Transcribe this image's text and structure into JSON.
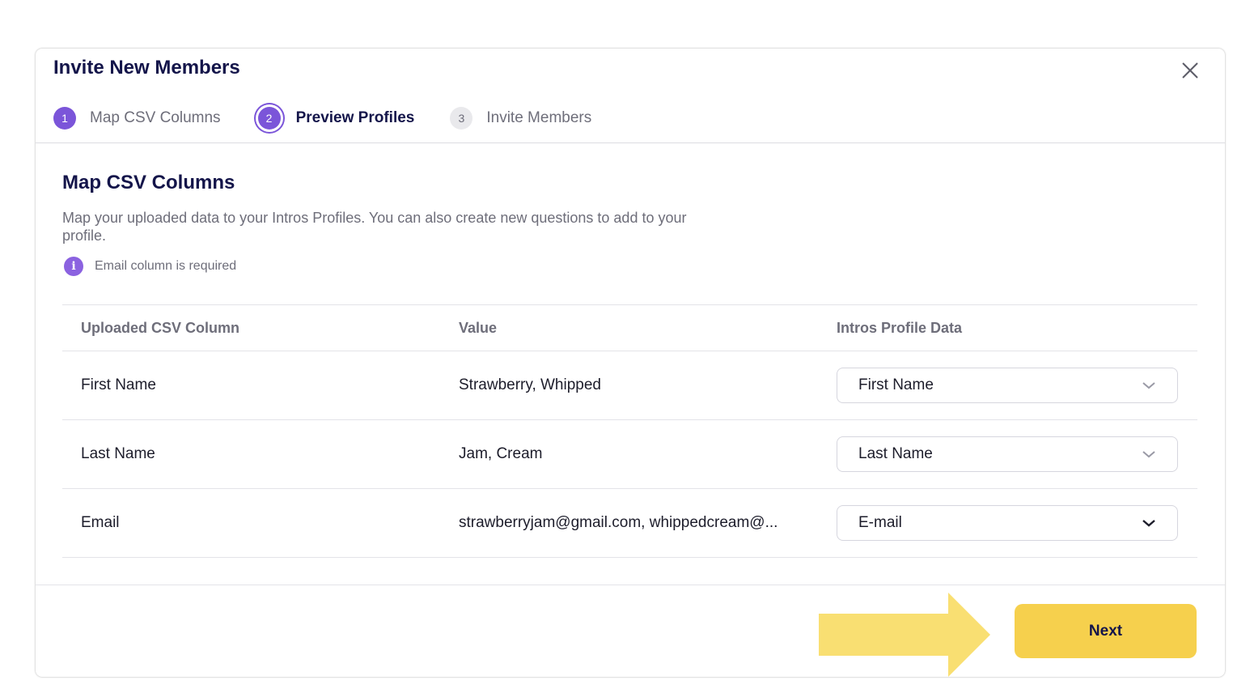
{
  "modal": {
    "title": "Invite New Members",
    "close_icon": "close-icon"
  },
  "stepper": {
    "steps": [
      {
        "number": "1",
        "label": "Map CSV Columns",
        "state": "completed"
      },
      {
        "number": "2",
        "label": "Preview Profiles",
        "state": "active"
      },
      {
        "number": "3",
        "label": "Invite Members",
        "state": "upcoming"
      }
    ]
  },
  "section": {
    "title": "Map CSV Columns",
    "description": "Map your uploaded data to your Intros Profiles. You can also create new questions to add to your profile.",
    "info_icon": "info-icon",
    "info_glyph": "i",
    "info_text": "Email column is required"
  },
  "table": {
    "headers": [
      "Uploaded CSV Column",
      "Value",
      "Intros Profile Data"
    ],
    "rows": [
      {
        "column": "First Name",
        "value": "Strawberry, Whipped",
        "mapping": "First Name"
      },
      {
        "column": "Last Name",
        "value": "Jam, Cream",
        "mapping": "Last Name"
      },
      {
        "column": "Email",
        "value": "strawberryjam@gmail.com, whippedcream@...",
        "mapping": "E-mail"
      }
    ]
  },
  "footer": {
    "next_label": "Next"
  },
  "colors": {
    "accent": "#7b55d9",
    "primary_button": "#f6d04d",
    "highlight_arrow": "#f9df72",
    "title_text": "#14154a"
  }
}
